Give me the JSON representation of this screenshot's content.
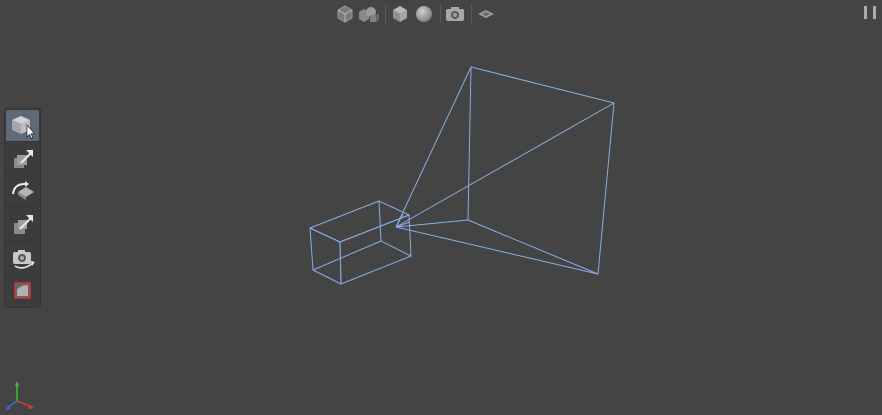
{
  "viewport": {
    "background": "#444444",
    "wireframe_color": "#86aee0"
  },
  "top_toolbar": {
    "buttons": [
      {
        "name": "wireframe-cube-mode-button",
        "icon": "wireframe-cube-icon"
      },
      {
        "name": "multi-object-mode-button",
        "icon": "multi-shapes-icon"
      },
      {
        "name": "solid-cube-mode-button",
        "icon": "solid-cube-icon"
      },
      {
        "name": "sphere-shading-button",
        "icon": "sphere-icon"
      },
      {
        "name": "camera-view-button",
        "icon": "camera-icon"
      },
      {
        "name": "grid-plane-button",
        "icon": "grid-plane-icon"
      }
    ],
    "pause_button": {
      "icon": "pause-icon"
    }
  },
  "left_tools": [
    {
      "name": "select-tool",
      "icon": "cube-cursor-icon",
      "active": true
    },
    {
      "name": "move-tool",
      "icon": "move-arrow-icon",
      "active": false
    },
    {
      "name": "rotate-tool",
      "icon": "rotate-icon",
      "active": false
    },
    {
      "name": "scale-tool",
      "icon": "scale-arrow-icon",
      "active": false
    },
    {
      "name": "orbit-camera-tool",
      "icon": "camera-orbit-icon",
      "active": false
    },
    {
      "name": "frustum-tool",
      "icon": "frustum-icon",
      "active": false
    }
  ],
  "axis_gizmo": {
    "colors": {
      "x": "#d03a3a",
      "y": "#3ac03a",
      "z": "#3a6ad0"
    }
  }
}
